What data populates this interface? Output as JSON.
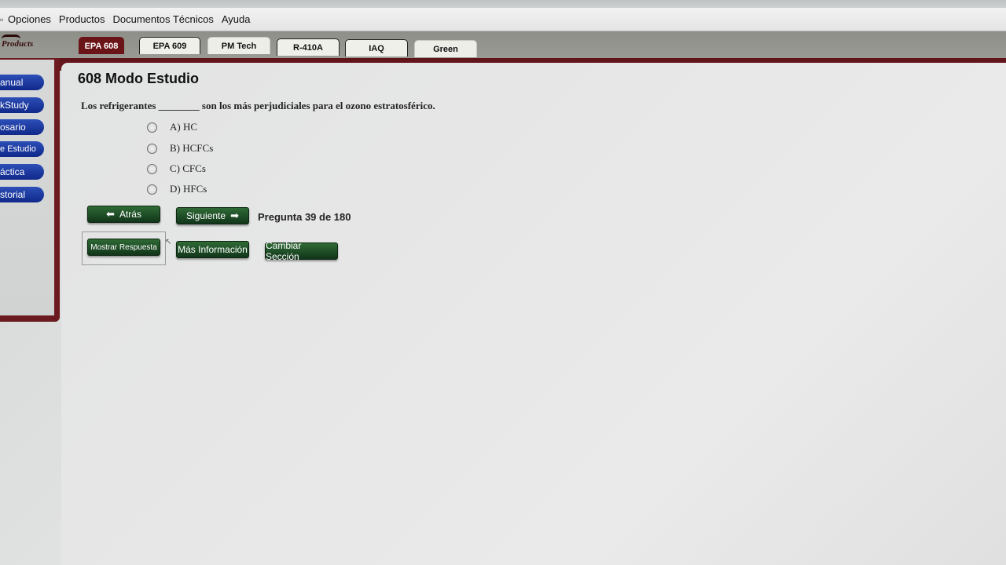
{
  "menubar": {
    "items": [
      "Opciones",
      "Productos",
      "Documentos Técnicos",
      "Ayuda"
    ]
  },
  "logo": {
    "text": "Products"
  },
  "tabs": [
    "EPA 608",
    "EPA 609",
    "PM Tech",
    "R-410A",
    "IAQ",
    "Green"
  ],
  "sidebar": {
    "items": [
      "anual",
      "kStudy",
      "osario",
      "e Estudio",
      "áctica",
      "storial"
    ]
  },
  "page": {
    "title": "608 Modo Estudio",
    "question": "Los refrigerantes ________ son los más perjudiciales para el ozono estratosférico.",
    "options": [
      "A) HC",
      "B) HCFCs",
      "C) CFCs",
      "D) HFCs"
    ],
    "counter": "Pregunta 39 de 180"
  },
  "buttons": {
    "back": "Atrás",
    "next": "Siguiente",
    "show_answer": "Mostrar Respuesta",
    "more_info": "Más Información",
    "change_section": "Cambiar Sección"
  },
  "colors": {
    "maroon": "#6b1a1f",
    "sidebar_blue": "#1a36a0",
    "button_green": "#1f4d25"
  }
}
